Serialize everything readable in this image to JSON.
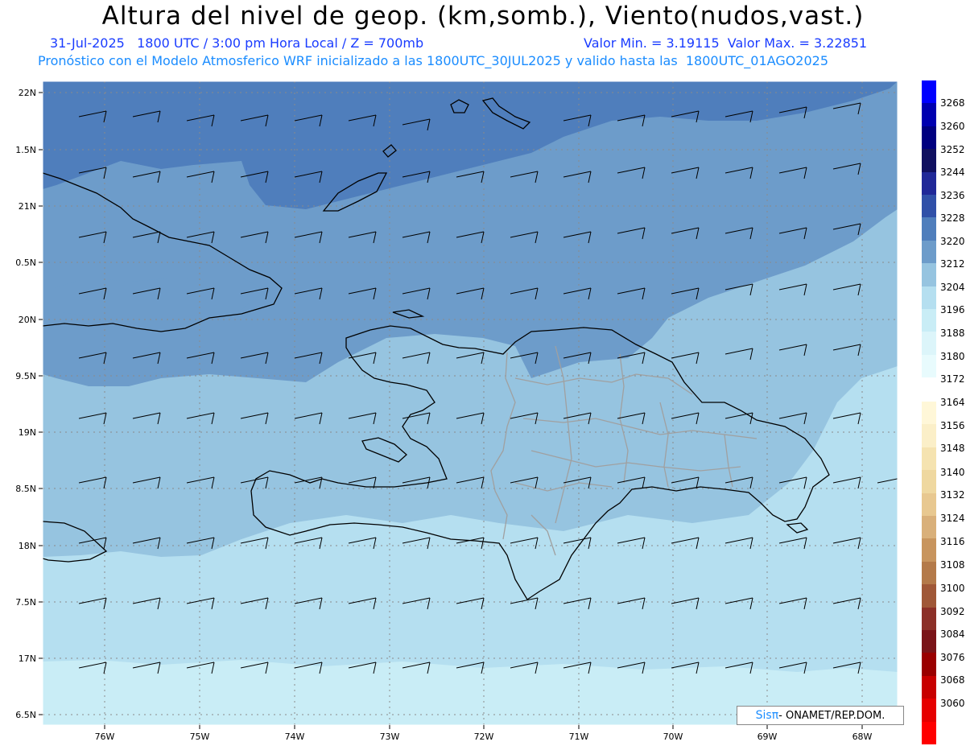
{
  "header": {
    "title": "Altura del nivel de geop. (km,somb.), Viento(nudos,vast.)",
    "line1_left": "31-Jul-2025   1800 UTC / 3:00 pm Hora Local / Z = 700mb",
    "line1_right": "Valor Min. = 3.19115  Valor Max. = 3.22851",
    "line2": "Pronóstico con el Modelo Atmosferico WRF inicializado a las 1800UTC_30JUL2025 y valido hasta las  1800UTC_01AGO2025"
  },
  "map": {
    "lat_labels": [
      "22N",
      "1.5N",
      "21N",
      "0.5N",
      "20N",
      "9.5N",
      "19N",
      "8.5N",
      "18N",
      "7.5N",
      "17N",
      "6.5N"
    ],
    "lon_labels": [
      "76W",
      "75W",
      "74W",
      "73W",
      "72W",
      "71W",
      "70W",
      "69W",
      "68W"
    ],
    "field_colors": {
      "deep": "#4f7ebc",
      "mid": "#6d9cca",
      "light": "#96c4e0",
      "pale": "#b5dff0",
      "palest": "#c9edf6"
    },
    "coast_color": "#000000",
    "province_color": "#a0a0a0"
  },
  "colorbar": {
    "labels": [
      "3268",
      "3260",
      "3252",
      "3244",
      "3236",
      "3228",
      "3220",
      "3212",
      "3204",
      "3196",
      "3188",
      "3180",
      "3172",
      "3164",
      "3156",
      "3148",
      "3140",
      "3132",
      "3124",
      "3116",
      "3108",
      "3100",
      "3092",
      "3084",
      "3076",
      "3068",
      "3060"
    ],
    "colors": [
      "#0000ff",
      "#0000b0",
      "#000080",
      "#101060",
      "#202898",
      "#3050a8",
      "#4f7ebc",
      "#6d9cca",
      "#96c4e0",
      "#b5dff0",
      "#c9edf6",
      "#dcf5fa",
      "#e8fbfd",
      "#fff7d8",
      "#fbefc8",
      "#f5e3b0",
      "#efd8a0",
      "#e8c890",
      "#d9b07a",
      "#c8955e",
      "#b47a4a",
      "#a05838",
      "#8c3028",
      "#7a1418",
      "#9a0000",
      "#c80000",
      "#e60000",
      "#ff0000"
    ]
  },
  "credit": {
    "brand": "Sisπ",
    "text": "- ONAMET/REP.DOM."
  }
}
